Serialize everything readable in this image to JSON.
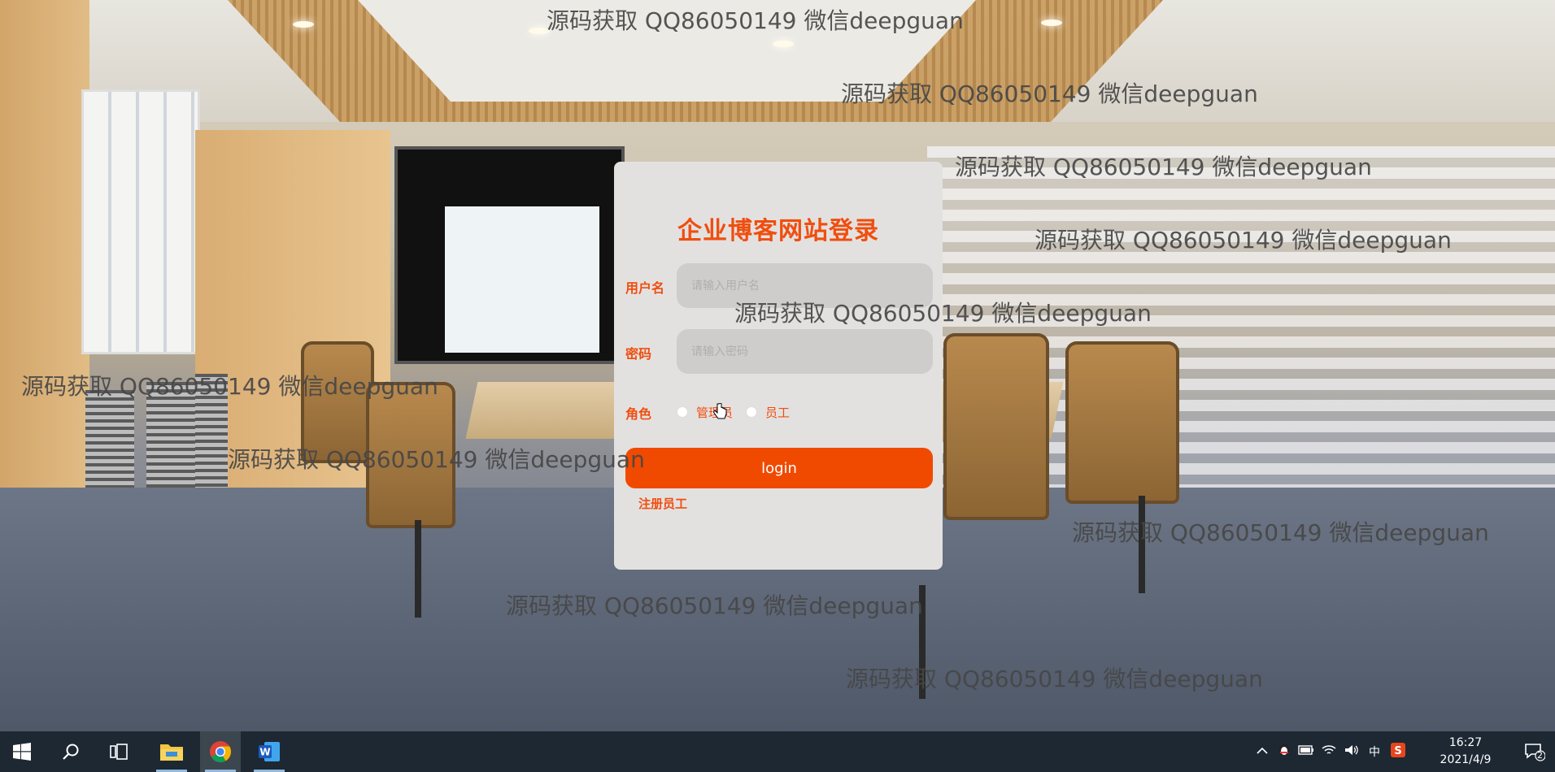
{
  "login": {
    "title": "企业博客网站登录",
    "username_label": "用户名",
    "username_placeholder": "请输入用户名",
    "password_label": "密码",
    "password_placeholder": "请输入密码",
    "role_label": "角色",
    "role_options": [
      "管理员",
      "员工"
    ],
    "login_button": "login",
    "register_link": "注册员工",
    "accent_color": "#f04e0f"
  },
  "watermark": "源码获取 QQ86050149 微信deepguan",
  "taskbar": {
    "apps": [
      "windows-start",
      "search",
      "task-view",
      "file-explorer",
      "chrome",
      "word"
    ],
    "active_app": "chrome",
    "tray": {
      "ime": "中",
      "time": "16:27",
      "date": "2021/4/9",
      "notifications": "2"
    }
  }
}
